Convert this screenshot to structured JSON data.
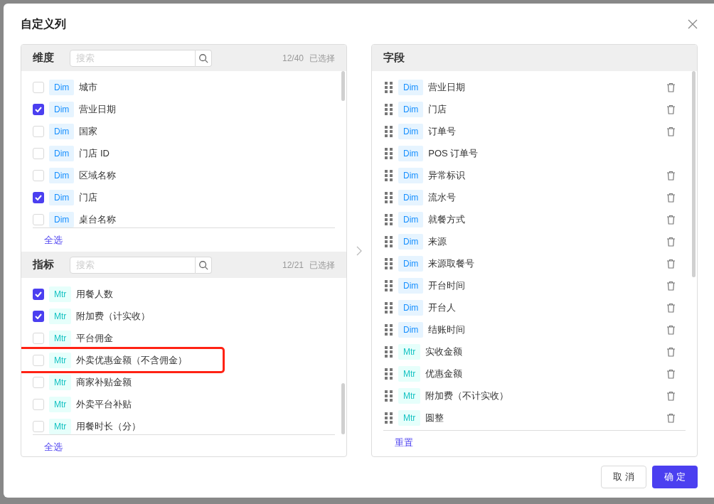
{
  "dialog": {
    "title": "自定义列"
  },
  "dimension_section": {
    "title": "维度",
    "search_placeholder": "搜索",
    "count": "12/40",
    "count_label": "已选择",
    "select_all": "全选",
    "items": [
      {
        "tag": "Dim",
        "label": "城市",
        "checked": false
      },
      {
        "tag": "Dim",
        "label": "营业日期",
        "checked": true
      },
      {
        "tag": "Dim",
        "label": "国家",
        "checked": false
      },
      {
        "tag": "Dim",
        "label": "门店 ID",
        "checked": false
      },
      {
        "tag": "Dim",
        "label": "区域名称",
        "checked": false
      },
      {
        "tag": "Dim",
        "label": "门店",
        "checked": true
      },
      {
        "tag": "Dim",
        "label": "桌台名称",
        "checked": false
      }
    ]
  },
  "metric_section": {
    "title": "指标",
    "search_placeholder": "搜索",
    "count": "12/21",
    "count_label": "已选择",
    "select_all": "全选",
    "items": [
      {
        "tag": "Mtr",
        "label": "用餐人数",
        "checked": true,
        "highlighted": false
      },
      {
        "tag": "Mtr",
        "label": "附加费（计实收）",
        "checked": true,
        "highlighted": false
      },
      {
        "tag": "Mtr",
        "label": "平台佣金",
        "checked": false,
        "highlighted": false
      },
      {
        "tag": "Mtr",
        "label": "外卖优惠金额（不含佣金）",
        "checked": false,
        "highlighted": true
      },
      {
        "tag": "Mtr",
        "label": "商家补贴金额",
        "checked": false,
        "highlighted": false
      },
      {
        "tag": "Mtr",
        "label": "外卖平台补贴",
        "checked": false,
        "highlighted": false
      },
      {
        "tag": "Mtr",
        "label": "用餐时长（分）",
        "checked": false,
        "highlighted": false
      }
    ]
  },
  "fields_panel": {
    "title": "字段",
    "reset": "重置",
    "items": [
      {
        "kind": "dim",
        "tag": "Dim",
        "label": "营业日期",
        "deletable": true
      },
      {
        "kind": "dim",
        "tag": "Dim",
        "label": "门店",
        "deletable": true
      },
      {
        "kind": "dim",
        "tag": "Dim",
        "label": "订单号",
        "deletable": true
      },
      {
        "kind": "dim",
        "tag": "Dim",
        "label": "POS 订单号",
        "deletable": false
      },
      {
        "kind": "dim",
        "tag": "Dim",
        "label": "异常标识",
        "deletable": true
      },
      {
        "kind": "dim",
        "tag": "Dim",
        "label": "流水号",
        "deletable": true
      },
      {
        "kind": "dim",
        "tag": "Dim",
        "label": "就餐方式",
        "deletable": true
      },
      {
        "kind": "dim",
        "tag": "Dim",
        "label": "来源",
        "deletable": true
      },
      {
        "kind": "dim",
        "tag": "Dim",
        "label": "来源取餐号",
        "deletable": true
      },
      {
        "kind": "dim",
        "tag": "Dim",
        "label": "开台时间",
        "deletable": true
      },
      {
        "kind": "dim",
        "tag": "Dim",
        "label": "开台人",
        "deletable": true
      },
      {
        "kind": "dim",
        "tag": "Dim",
        "label": "结账时间",
        "deletable": true
      },
      {
        "kind": "mtr",
        "tag": "Mtr",
        "label": "实收金额",
        "deletable": true
      },
      {
        "kind": "mtr",
        "tag": "Mtr",
        "label": "优惠金额",
        "deletable": true
      },
      {
        "kind": "mtr",
        "tag": "Mtr",
        "label": "附加费（不计实收）",
        "deletable": true
      },
      {
        "kind": "mtr",
        "tag": "Mtr",
        "label": "圆整",
        "deletable": true
      }
    ]
  },
  "buttons": {
    "cancel": "取 消",
    "ok": "确 定"
  }
}
